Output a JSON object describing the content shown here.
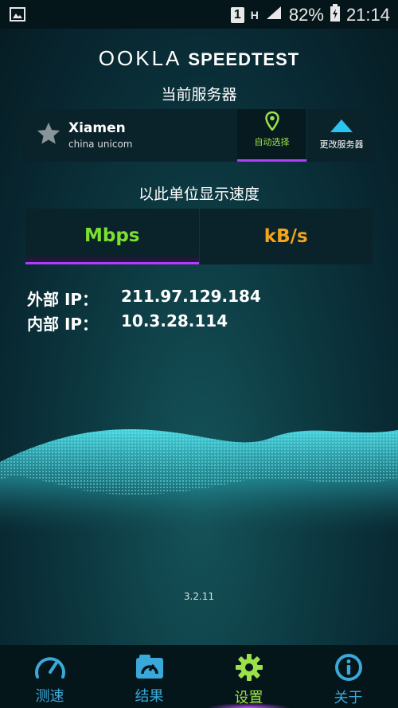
{
  "status_bar": {
    "sim": "1",
    "network": "H",
    "battery": "82%",
    "time": "21:14"
  },
  "logo": {
    "brand": "OOKLA",
    "product": "SPEEDTEST"
  },
  "server_section": {
    "title": "当前服务器",
    "server_name": "Xiamen",
    "server_isp": "china unicom",
    "auto_select_label": "自动选择",
    "change_server_label": "更改服务器"
  },
  "unit_section": {
    "title": "以此单位显示速度",
    "options": [
      "Mbps",
      "kB/s"
    ],
    "selected": "Mbps"
  },
  "ip_info": {
    "external_label": "外部 IP：",
    "external_value": "211.97.129.184",
    "internal_label": "内部 IP：",
    "internal_value": "10.3.28.114"
  },
  "version": "3.2.11",
  "nav": {
    "items": [
      {
        "label": "测速",
        "icon": "speedometer-icon"
      },
      {
        "label": "结果",
        "icon": "results-icon"
      },
      {
        "label": "设置",
        "icon": "gear-icon"
      },
      {
        "label": "关于",
        "icon": "info-icon"
      }
    ],
    "active": "设置"
  },
  "colors": {
    "accent_green": "#9be24a",
    "accent_orange": "#f2a51b",
    "accent_purple": "#b43cff",
    "nav_blue": "#3aa8d8"
  }
}
